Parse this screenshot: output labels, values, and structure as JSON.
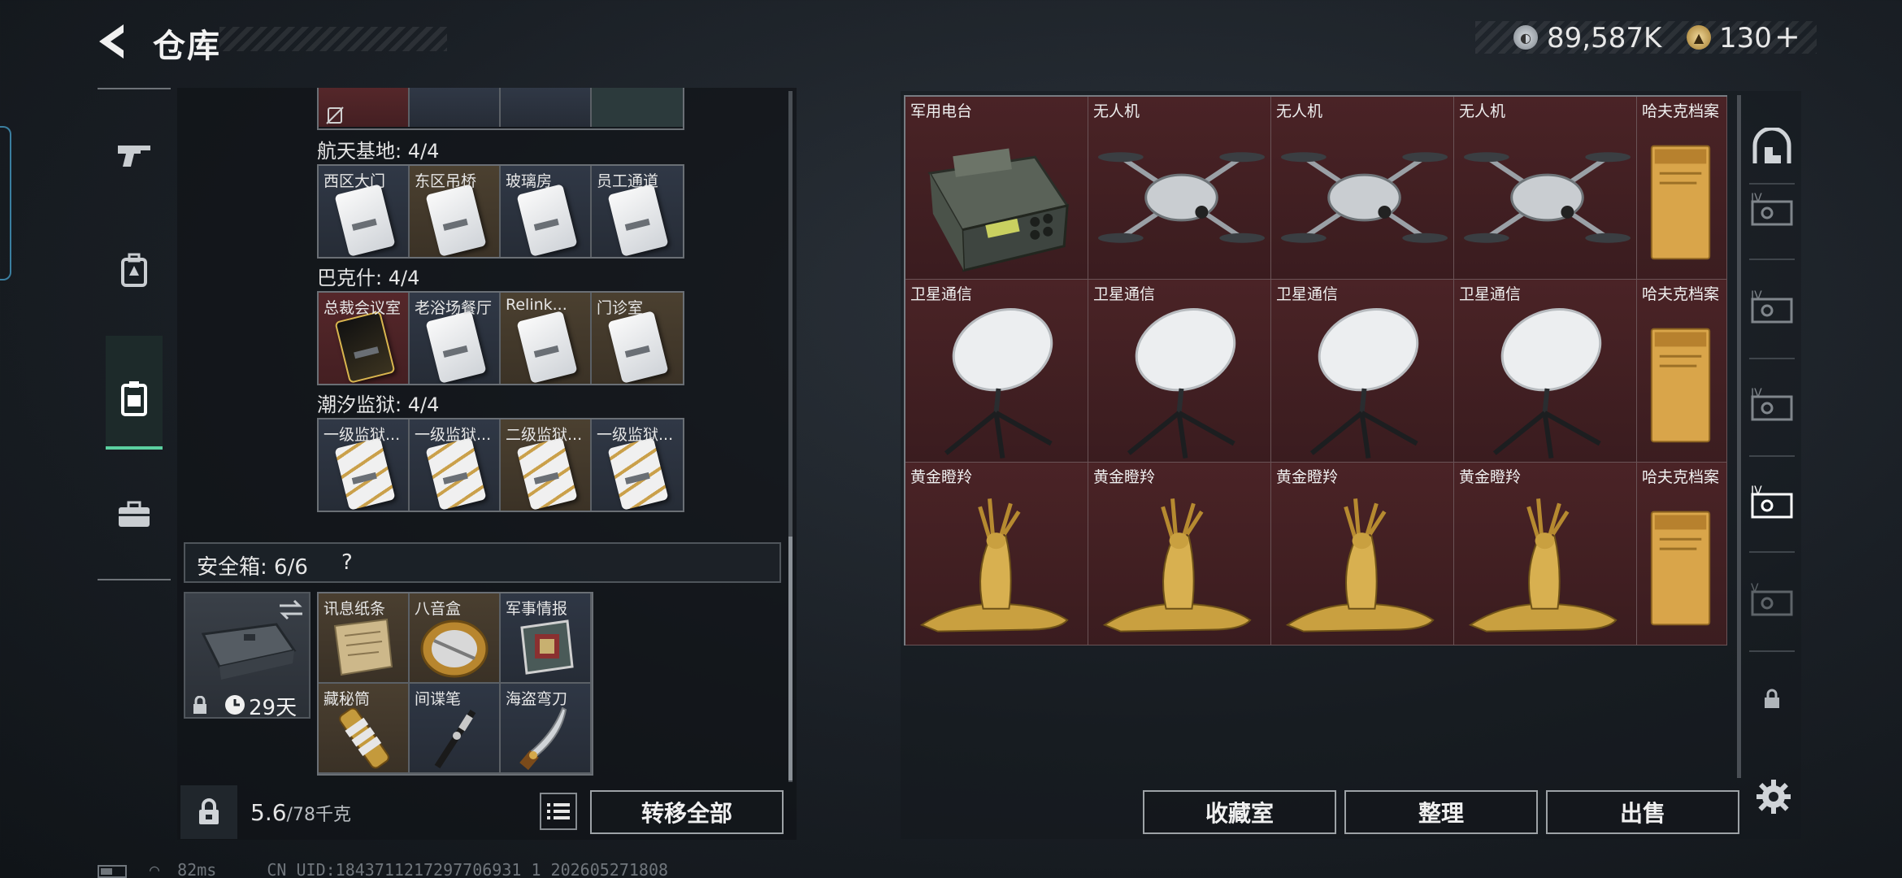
{
  "header": {
    "title": "仓库",
    "currency1_value": "89,587K",
    "currency2_value": "130",
    "add_label": "+"
  },
  "left": {
    "groups": [
      {
        "title": "航天基地: 4/4",
        "keys": [
          "西区大门",
          "东区吊桥",
          "玻璃房",
          "员工通道"
        ]
      },
      {
        "title": "巴克什: 4/4",
        "keys": [
          "总裁会议室",
          "老浴场餐厅",
          "Relink...",
          "门诊室"
        ]
      },
      {
        "title": "潮汐监狱: 4/4",
        "keys": [
          "一级监狱...",
          "一级监狱...",
          "二级监狱...",
          "一级监狱..."
        ]
      }
    ],
    "safe_box": {
      "title": "安全箱: 6/6",
      "help": "?",
      "days": "29天",
      "items": [
        "讯息纸条",
        "八音盒",
        "军事情报",
        "藏秘筒",
        "间谍笔",
        "海盗弯刀"
      ]
    },
    "weight_value": "5.6",
    "weight_total": "/78千克",
    "transfer_all": "转移全部"
  },
  "grid": {
    "items": [
      "军用电台",
      "无人机",
      "无人机",
      "无人机",
      "哈夫克档案",
      "卫星通信",
      "卫星通信",
      "卫星通信",
      "卫星通信",
      "哈夫克档案",
      "黄金瞪羚",
      "黄金瞪羚",
      "黄金瞪羚",
      "黄金瞪羚",
      "哈夫克档案"
    ]
  },
  "right_nav": {
    "tiers": [
      "IV",
      "IV",
      "IV",
      "IV",
      "V"
    ]
  },
  "actions": {
    "collection": "收藏室",
    "arrange": "整理",
    "sell": "出售"
  },
  "status": {
    "ping": "82ms",
    "uid": "CN UID:1843711217297706931 1_202605271808"
  },
  "colors": {
    "accent_green": "#5bd0a0",
    "item_bg": "#4a2326",
    "panel_bg": "#101418"
  }
}
